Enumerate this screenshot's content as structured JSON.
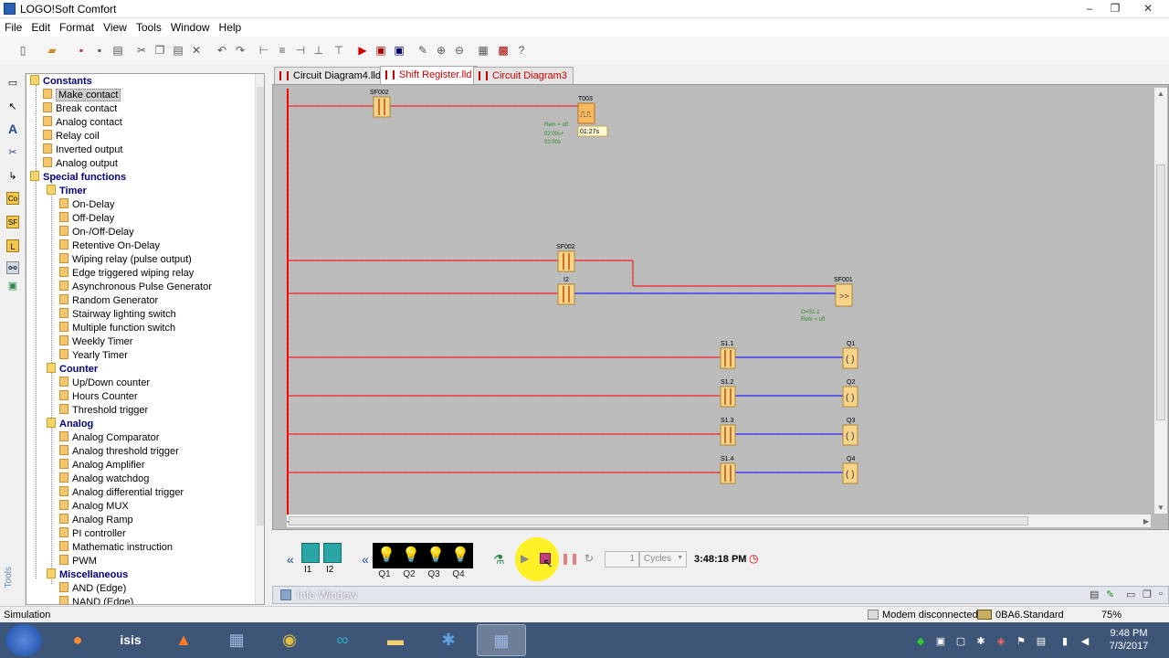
{
  "window": {
    "title": "LOGO!Soft Comfort"
  },
  "menu": [
    "File",
    "Edit",
    "Format",
    "View",
    "Tools",
    "Window",
    "Help"
  ],
  "tabs": [
    {
      "label": "Circuit Diagram4.lld",
      "active": false
    },
    {
      "label": "Shift Register.lld",
      "active": true
    },
    {
      "label": "Circuit Diagram3",
      "active": false
    }
  ],
  "tree": {
    "constants": {
      "label": "Constants",
      "items": [
        "Make contact",
        "Break contact",
        "Analog contact",
        "Relay coil",
        "Inverted output",
        "Analog output"
      ]
    },
    "special": {
      "label": "Special functions"
    },
    "timer": {
      "label": "Timer",
      "items": [
        "On-Delay",
        "Off-Delay",
        "On-/Off-Delay",
        "Retentive On-Delay",
        "Wiping relay (pulse output)",
        "Edge triggered wiping relay",
        "Asynchronous Pulse Generator",
        "Random Generator",
        "Stairway lighting switch",
        "Multiple function switch",
        "Weekly Timer",
        "Yearly Timer"
      ]
    },
    "counter": {
      "label": "Counter",
      "items": [
        "Up/Down counter",
        "Hours Counter",
        "Threshold trigger"
      ]
    },
    "analog": {
      "label": "Analog",
      "items": [
        "Analog Comparator",
        "Analog threshold trigger",
        "Analog Amplifier",
        "Analog watchdog",
        "Analog differential trigger",
        "Analog MUX",
        "Analog Ramp",
        "PI controller",
        "Mathematic instruction",
        "PWM"
      ]
    },
    "misc": {
      "label": "Miscellaneous",
      "items": [
        "AND (Edge)",
        "NAND (Edge)"
      ]
    }
  },
  "diagram": {
    "blocks": {
      "sf002_top": "SF002",
      "t003": "T003",
      "t003_time": "01:27s",
      "t003_params": [
        "Rem = off",
        "02:00s+",
        "02:00s"
      ],
      "sf002_mid": "SF002",
      "i2": "I2",
      "sf001": "SF001",
      "sf001_params": [
        "O=S1.1",
        "Rem = off"
      ],
      "s11": "S1.1",
      "s12": "S1.2",
      "s13": "S1.3",
      "s14": "S1.4",
      "q1": "Q1",
      "q2": "Q2",
      "q3": "Q3",
      "q4": "Q4"
    }
  },
  "simulation": {
    "inputs": [
      "I1",
      "I2"
    ],
    "outputs": [
      "Q1",
      "Q2",
      "Q3",
      "Q4"
    ],
    "cycles_value": "1",
    "cycles_label": "Cycles",
    "time": "3:48:18 PM"
  },
  "info_window": {
    "label": "Info Window"
  },
  "status": {
    "mode": "Simulation",
    "modem": "Modem disconnected",
    "device": "0BA6.Standard",
    "zoom": "75%"
  },
  "taskbar": {
    "time": "9:48 PM",
    "date": "7/3/2017",
    "apps": [
      "start-orb",
      "firefox",
      "isis",
      "matlab",
      "logo-soft",
      "chrome",
      "arduino",
      "explorer",
      "app-blue",
      "logo-soft-active"
    ]
  }
}
